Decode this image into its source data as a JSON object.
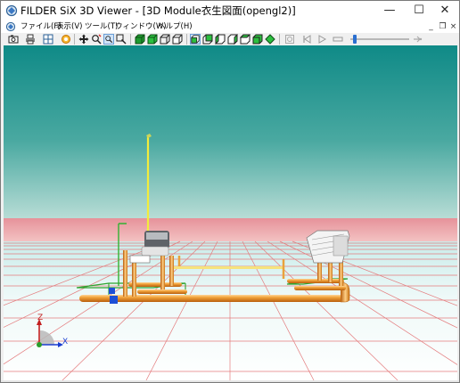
{
  "window": {
    "title": "FILDER SiX 3D Viewer - [3D Module衣生図面(opengl2)]",
    "controls": {
      "minimize": "—",
      "maximize": "☐",
      "close": "✕"
    }
  },
  "menubar": {
    "items": [
      {
        "label": "ファイル(F)"
      },
      {
        "label": "表示(V)"
      },
      {
        "label": "ツール(T)"
      },
      {
        "label": "ウィンドウ(W)"
      },
      {
        "label": "ヘルプ(H)"
      }
    ],
    "mdi_controls": {
      "minimize": "_",
      "restore": "❐",
      "close": "×"
    }
  },
  "toolbar": {
    "icons": [
      "camera-icon",
      "print-icon",
      "grid-icon",
      "layers-icon",
      "move-icon",
      "zoom-region-icon",
      "fit-view-icon",
      "zoom-icon",
      "solid-cube-icon",
      "shaded-cube-icon",
      "wire-cube-icon",
      "hidden-cube-icon",
      "view-front-icon",
      "view-back-icon",
      "view-left-icon",
      "view-right-icon",
      "view-top-icon",
      "view-iso-icon",
      "settings-icon",
      "first-frame-icon",
      "play-icon",
      "stop-icon",
      "slider",
      "end-icon"
    ],
    "animation_slider_value": 0.08
  },
  "axes": {
    "x_label": "X",
    "z_label": "Z"
  },
  "colors": {
    "sky_top": "#1a8d8b",
    "sky_horizon": "#a8d6d0",
    "horizon_band": "#e89a9c",
    "floor": "#f4fbfa",
    "grid_line": "#e06a6c",
    "pipe": "#e9952e",
    "pipe_highlight": "#ffd79a",
    "green_frame": "#2fa32f",
    "yellow_pipe": "#e8e23a"
  }
}
